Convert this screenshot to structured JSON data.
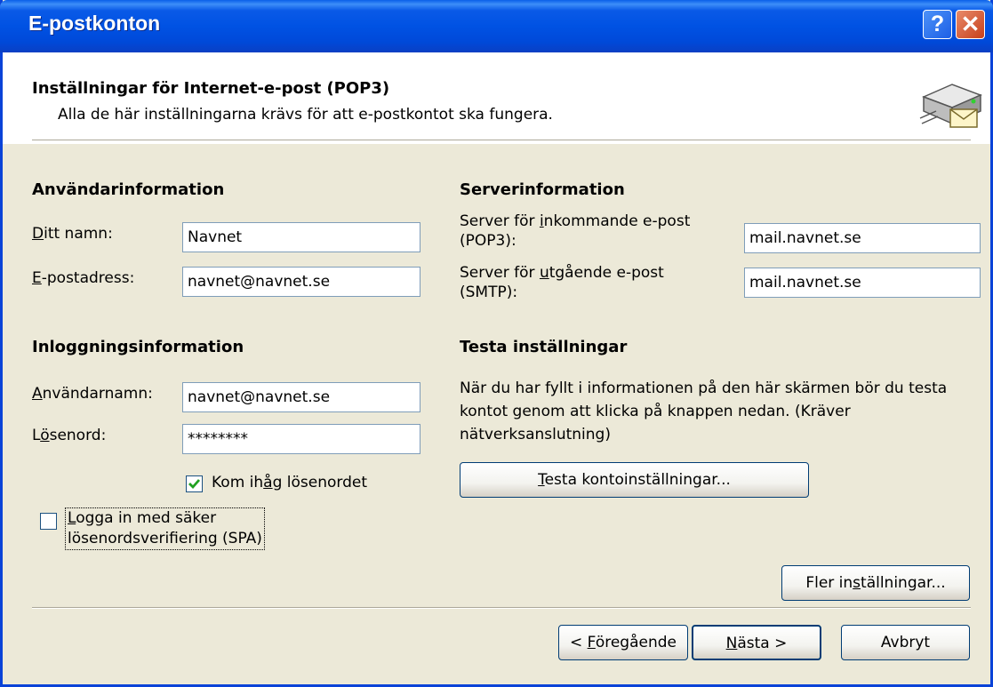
{
  "window": {
    "title": "E-postkonton",
    "help_label": "?",
    "close_label": "✕"
  },
  "header": {
    "title": "Inställningar för Internet-e-post (POP3)",
    "subtitle": "Alla de här inställningarna krävs för att e-postkontot ska fungera.",
    "icon": "server-mail-icon"
  },
  "user_info": {
    "heading": "Användarinformation",
    "name_label_u": "D",
    "name_label_rest": "itt namn:",
    "name_value": "Navnet",
    "email_label_u": "E",
    "email_label_rest": "-postadress:",
    "email_value": "navnet@navnet.se"
  },
  "server_info": {
    "heading": "Serverinformation",
    "incoming_label_pre": "Server för ",
    "incoming_label_u": "i",
    "incoming_label_post": "nkommande e-post",
    "incoming_label_line2": "(POP3):",
    "incoming_value": "mail.navnet.se",
    "outgoing_label_pre": "Server för ",
    "outgoing_label_u": "u",
    "outgoing_label_post": "tgående e-post",
    "outgoing_label_line2": "(SMTP):",
    "outgoing_value": "mail.navnet.se"
  },
  "login_info": {
    "heading": "Inloggningsinformation",
    "username_label_u": "A",
    "username_label_rest": "nvändarnamn:",
    "username_value": "navnet@navnet.se",
    "password_label_pre": "L",
    "password_label_u": "ö",
    "password_label_rest": "senord:",
    "password_value": "********",
    "remember_label_pre": "Kom ih",
    "remember_label_u": "å",
    "remember_label_rest": "g lösenordet",
    "remember_checked": true,
    "spa_label_u": "L",
    "spa_label_rest": "ogga in med säker",
    "spa_label_line2": "lösenordsverifiering (SPA)",
    "spa_checked": false
  },
  "test": {
    "heading": "Testa inställningar",
    "description": "När du har fyllt i informationen på den här skärmen bör du testa kontot genom att klicka på knappen nedan. (Kräver nätverksanslutning)",
    "button_u": "T",
    "button_rest": "esta kontoinställningar..."
  },
  "more_settings": {
    "pre": "Fler in",
    "u": "s",
    "rest": "tällningar..."
  },
  "nav": {
    "back_pre": "< ",
    "back_u": "F",
    "back_rest": "öregående",
    "next_u": "N",
    "next_rest": "ästa >",
    "cancel_label": "Avbryt"
  },
  "colors": {
    "title_bar": "#0052e3",
    "dialog_bg": "#ece9d8",
    "input_border": "#7f9db9",
    "button_border": "#003c74"
  }
}
